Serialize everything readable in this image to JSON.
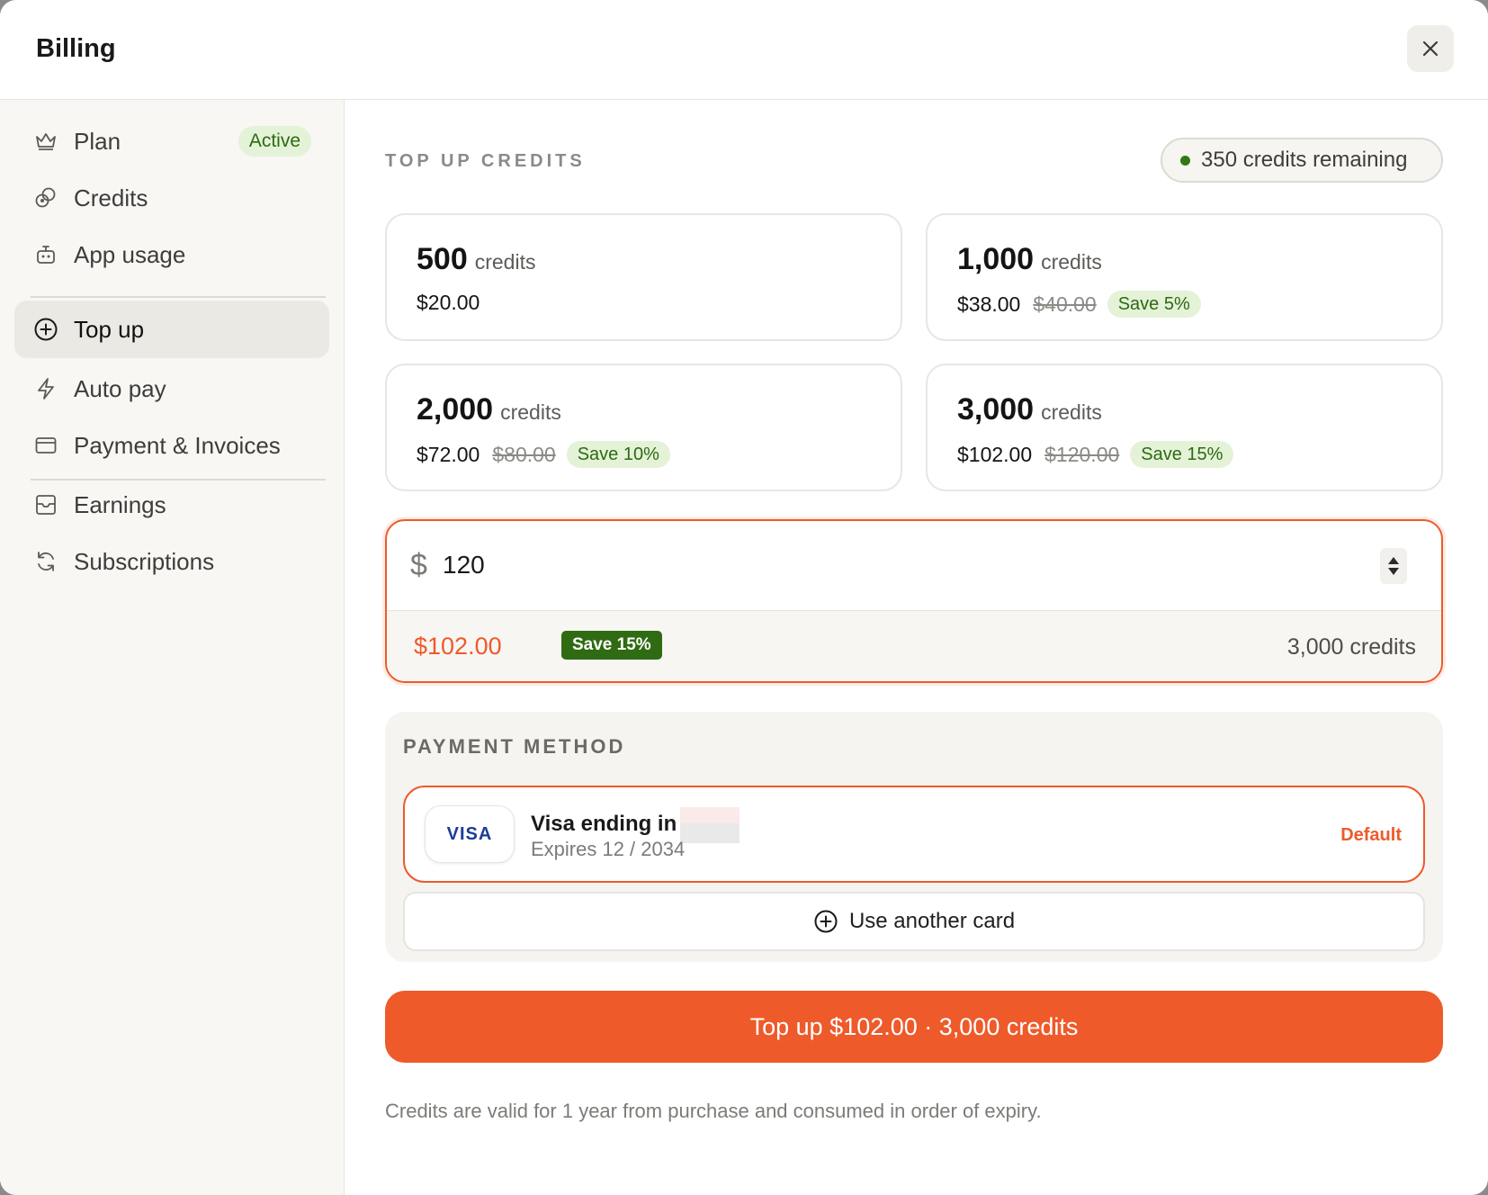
{
  "header": {
    "title": "Billing"
  },
  "sidebar": {
    "items": [
      {
        "id": "plan",
        "label": "Plan",
        "badge": "Active",
        "icon": "crown-icon"
      },
      {
        "id": "credits",
        "label": "Credits",
        "icon": "coins-icon"
      },
      {
        "id": "app-usage",
        "label": "App usage",
        "icon": "bot-icon"
      },
      {
        "id": "top-up",
        "label": "Top up",
        "icon": "plus-circle-icon",
        "active": true
      },
      {
        "id": "auto-pay",
        "label": "Auto pay",
        "icon": "lightning-icon"
      },
      {
        "id": "payment-invoices",
        "label": "Payment & Invoices",
        "icon": "credit-card-icon"
      },
      {
        "id": "earnings",
        "label": "Earnings",
        "icon": "inbox-icon"
      },
      {
        "id": "subscriptions",
        "label": "Subscriptions",
        "icon": "refresh-icon"
      }
    ]
  },
  "topup": {
    "section_title": "TOP UP CREDITS",
    "remaining": "350 credits remaining",
    "packs": [
      {
        "amount": "500",
        "unit": "credits",
        "price": "$20.00",
        "original": "",
        "save": ""
      },
      {
        "amount": "1,000",
        "unit": "credits",
        "price": "$38.00",
        "original": "$40.00",
        "save": "Save 5%"
      },
      {
        "amount": "2,000",
        "unit": "credits",
        "price": "$72.00",
        "original": "$80.00",
        "save": "Save 10%"
      },
      {
        "amount": "3,000",
        "unit": "credits",
        "price": "$102.00",
        "original": "$120.00",
        "save": "Save 15%"
      }
    ],
    "custom": {
      "currency": "$",
      "value": "120",
      "price": "$102.00",
      "save": "Save 15%",
      "credits": "3,000 credits"
    }
  },
  "payment": {
    "title": "PAYMENT METHOD",
    "card": {
      "brand": "VISA",
      "name": "Visa ending in",
      "expires": "Expires 12 / 2034",
      "default_label": "Default"
    },
    "another_label": "Use another card"
  },
  "cta": {
    "label": "Top up $102.00 · 3,000 credits"
  },
  "footnote": "Credits are valid for 1 year from purchase and consumed in order of expiry.",
  "colors": {
    "accent": "#ee5a2a",
    "success_bg": "#e4f2d8",
    "success_text": "#2d6a12",
    "save_dark": "#2f6b12"
  }
}
